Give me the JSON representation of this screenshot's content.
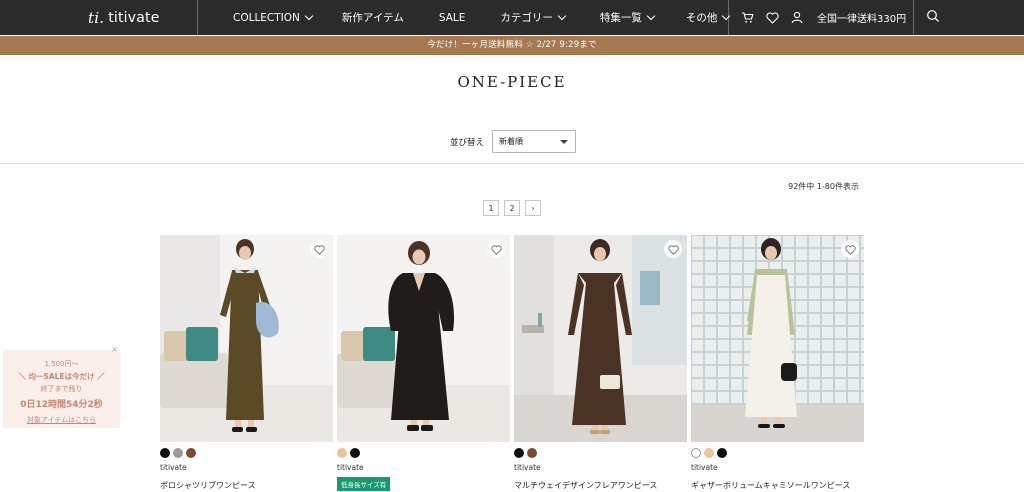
{
  "header": {
    "logo_script": "ti.",
    "logo_text": "titivate",
    "menu": [
      {
        "label": "COLLECTION",
        "dropdown": true
      },
      {
        "label": "新作アイテム",
        "dropdown": false
      },
      {
        "label": "SALE",
        "dropdown": false
      },
      {
        "label": "カテゴリー",
        "dropdown": true
      },
      {
        "label": "特集一覧",
        "dropdown": true
      },
      {
        "label": "その他",
        "dropdown": true
      }
    ],
    "shipping": "全国一律送料330円",
    "icons": [
      "cart-icon",
      "heart-icon",
      "user-icon",
      "search-icon"
    ]
  },
  "promo_bar": "今だけ！一ヶ月送料無料 ☆ 2/27 9:29まで",
  "page_title": "ONE-PIECE",
  "sort": {
    "label": "並び替え",
    "selected": "新着順"
  },
  "result_count": "92件中 1-80件表示",
  "pagination": {
    "pages": [
      "1",
      "2"
    ],
    "next": "›"
  },
  "products": [
    {
      "brand": "titivate",
      "name": "ポロシャツリブワンピース",
      "badge": "",
      "swatches": [
        "#111111",
        "#9a9a9a",
        "#7a4a33"
      ]
    },
    {
      "brand": "titivate",
      "name": "",
      "badge": "低身長サイズ有",
      "swatches": [
        "#e6c79c",
        "#111111"
      ]
    },
    {
      "brand": "titivate",
      "name": "マルチウェイデザインフレアワンピース",
      "badge": "",
      "swatches": [
        "#111111",
        "#7a4a33"
      ]
    },
    {
      "brand": "titivate",
      "name": "ギャザーボリュームキャミソールワンピース",
      "badge": "",
      "swatches": [
        "#ffffff",
        "#e6c79c",
        "#111111"
      ]
    }
  ],
  "sale_popup": {
    "close": "×",
    "line1": "1,500円〜",
    "line2": "＼ 均一SALEは今だけ ／",
    "line3": "終了まで残り",
    "line4": "0日12時間54分2秒",
    "link": "対象アイテムはこちら"
  }
}
